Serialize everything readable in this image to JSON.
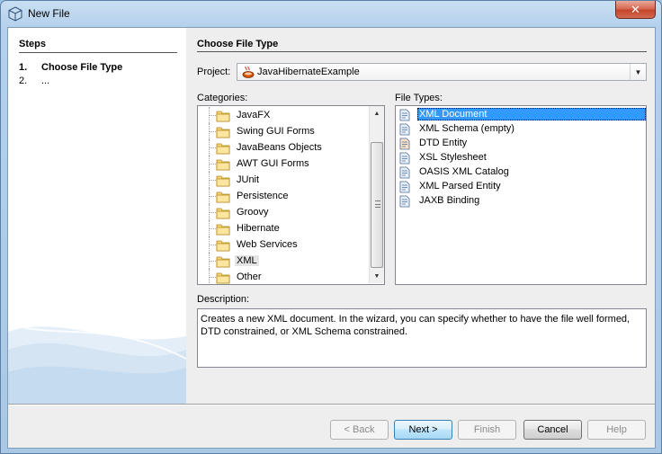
{
  "window": {
    "title": "New File",
    "close_label": "✕"
  },
  "steps": {
    "heading": "Steps",
    "items": [
      {
        "num": "1.",
        "label": "Choose File Type",
        "active": true
      },
      {
        "num": "2.",
        "label": "...",
        "active": false
      }
    ]
  },
  "main": {
    "heading": "Choose File Type",
    "project_label": "Project:",
    "project_value": "JavaHibernateExample",
    "categories_label": "Categories:",
    "categories": [
      "JavaFX",
      "Swing GUI Forms",
      "JavaBeans Objects",
      "AWT GUI Forms",
      "JUnit",
      "Persistence",
      "Groovy",
      "Hibernate",
      "Web Services",
      "XML",
      "Other"
    ],
    "selected_category": "XML",
    "file_types_label": "File Types:",
    "file_types": [
      {
        "label": "XML Document",
        "icon": "xml-document-icon"
      },
      {
        "label": "XML Schema (empty)",
        "icon": "xml-schema-icon"
      },
      {
        "label": "DTD Entity",
        "icon": "dtd-entity-icon"
      },
      {
        "label": "XSL Stylesheet",
        "icon": "xsl-stylesheet-icon"
      },
      {
        "label": "OASIS XML Catalog",
        "icon": "xml-catalog-icon"
      },
      {
        "label": "XML Parsed Entity",
        "icon": "parsed-entity-icon"
      },
      {
        "label": "JAXB Binding",
        "icon": "jaxb-binding-icon"
      }
    ],
    "selected_file_type": "XML Document",
    "description_label": "Description:",
    "description": "Creates a new XML document. In the wizard, you can specify whether to have the file well formed, DTD constrained, or XML Schema constrained."
  },
  "buttons": {
    "back": "< Back",
    "next": "Next >",
    "finish": "Finish",
    "cancel": "Cancel",
    "help": "Help"
  },
  "colors": {
    "selection": "#3399ff",
    "title_bar": "#b4d0ec",
    "close": "#c4422a"
  }
}
